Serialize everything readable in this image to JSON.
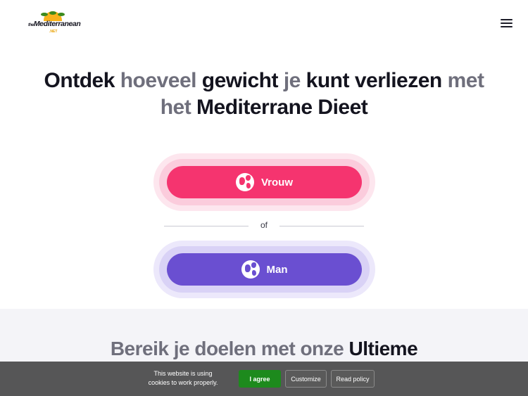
{
  "header": {
    "logo_prefix": "the",
    "logo_word": "Mediterranean",
    "logo_domain": ".NET",
    "menu_icon": "hamburger-menu-icon"
  },
  "hero": {
    "title_parts": [
      {
        "text": "Ontdek ",
        "style": "dark"
      },
      {
        "text": "hoeveel ",
        "style": "muted"
      },
      {
        "text": "gewicht ",
        "style": "dark"
      },
      {
        "text": "je ",
        "style": "muted"
      },
      {
        "text": "kunt verliezen ",
        "style": "dark"
      },
      {
        "text": "met",
        "style": "muted"
      }
    ],
    "title_line2_parts": [
      {
        "text": "het ",
        "style": "muted"
      },
      {
        "text": "Mediterrane Dieet",
        "style": "dark"
      }
    ]
  },
  "choices": {
    "female_label": "Vrouw",
    "female_icon": "globe-icon",
    "female_color": "#f5346f",
    "divider_text": "of",
    "male_label": "Man",
    "male_icon": "globe-icon",
    "male_color": "#6a4fd1"
  },
  "section2": {
    "title_muted": "Bereik je doelen met onze ",
    "title_dark": "Ultieme"
  },
  "cookie": {
    "text": "This website is using cookies to work properly.",
    "agree_label": "I agree",
    "customize_label": "Customize",
    "policy_label": "Read policy",
    "agree_color": "#1d8a1d"
  }
}
